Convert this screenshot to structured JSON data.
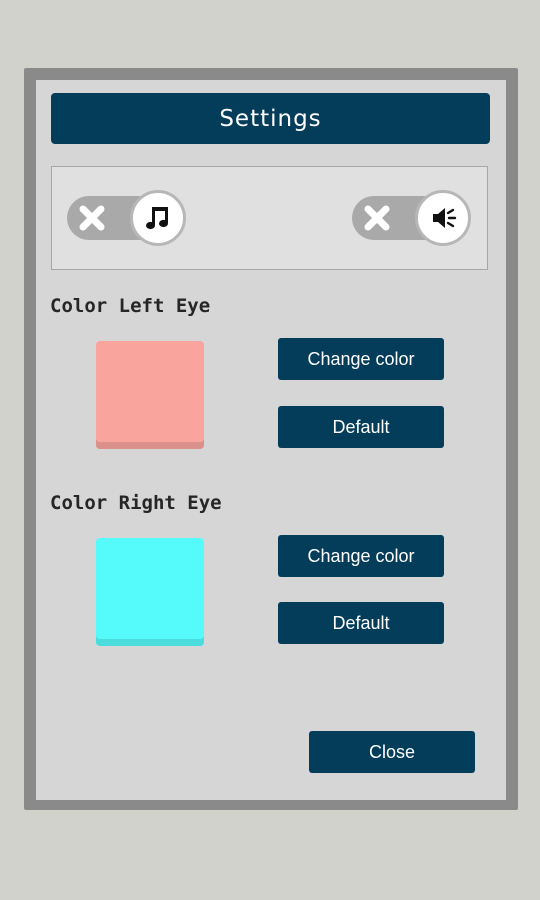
{
  "dialog": {
    "title": "Settings"
  },
  "toggles": {
    "music": {
      "icon": "music-note-icon",
      "state": "on"
    },
    "sound": {
      "icon": "speaker-icon",
      "state": "on"
    }
  },
  "left_eye": {
    "label": "Color Left Eye",
    "color": "#f9a59e",
    "change_label": "Change color",
    "default_label": "Default"
  },
  "right_eye": {
    "label": "Color Right Eye",
    "color": "#55fbfb",
    "change_label": "Change color",
    "default_label": "Default"
  },
  "close_label": "Close",
  "colors": {
    "accent": "#043d5a",
    "background": "#d2d2cc",
    "panel": "#d6d6d6"
  }
}
